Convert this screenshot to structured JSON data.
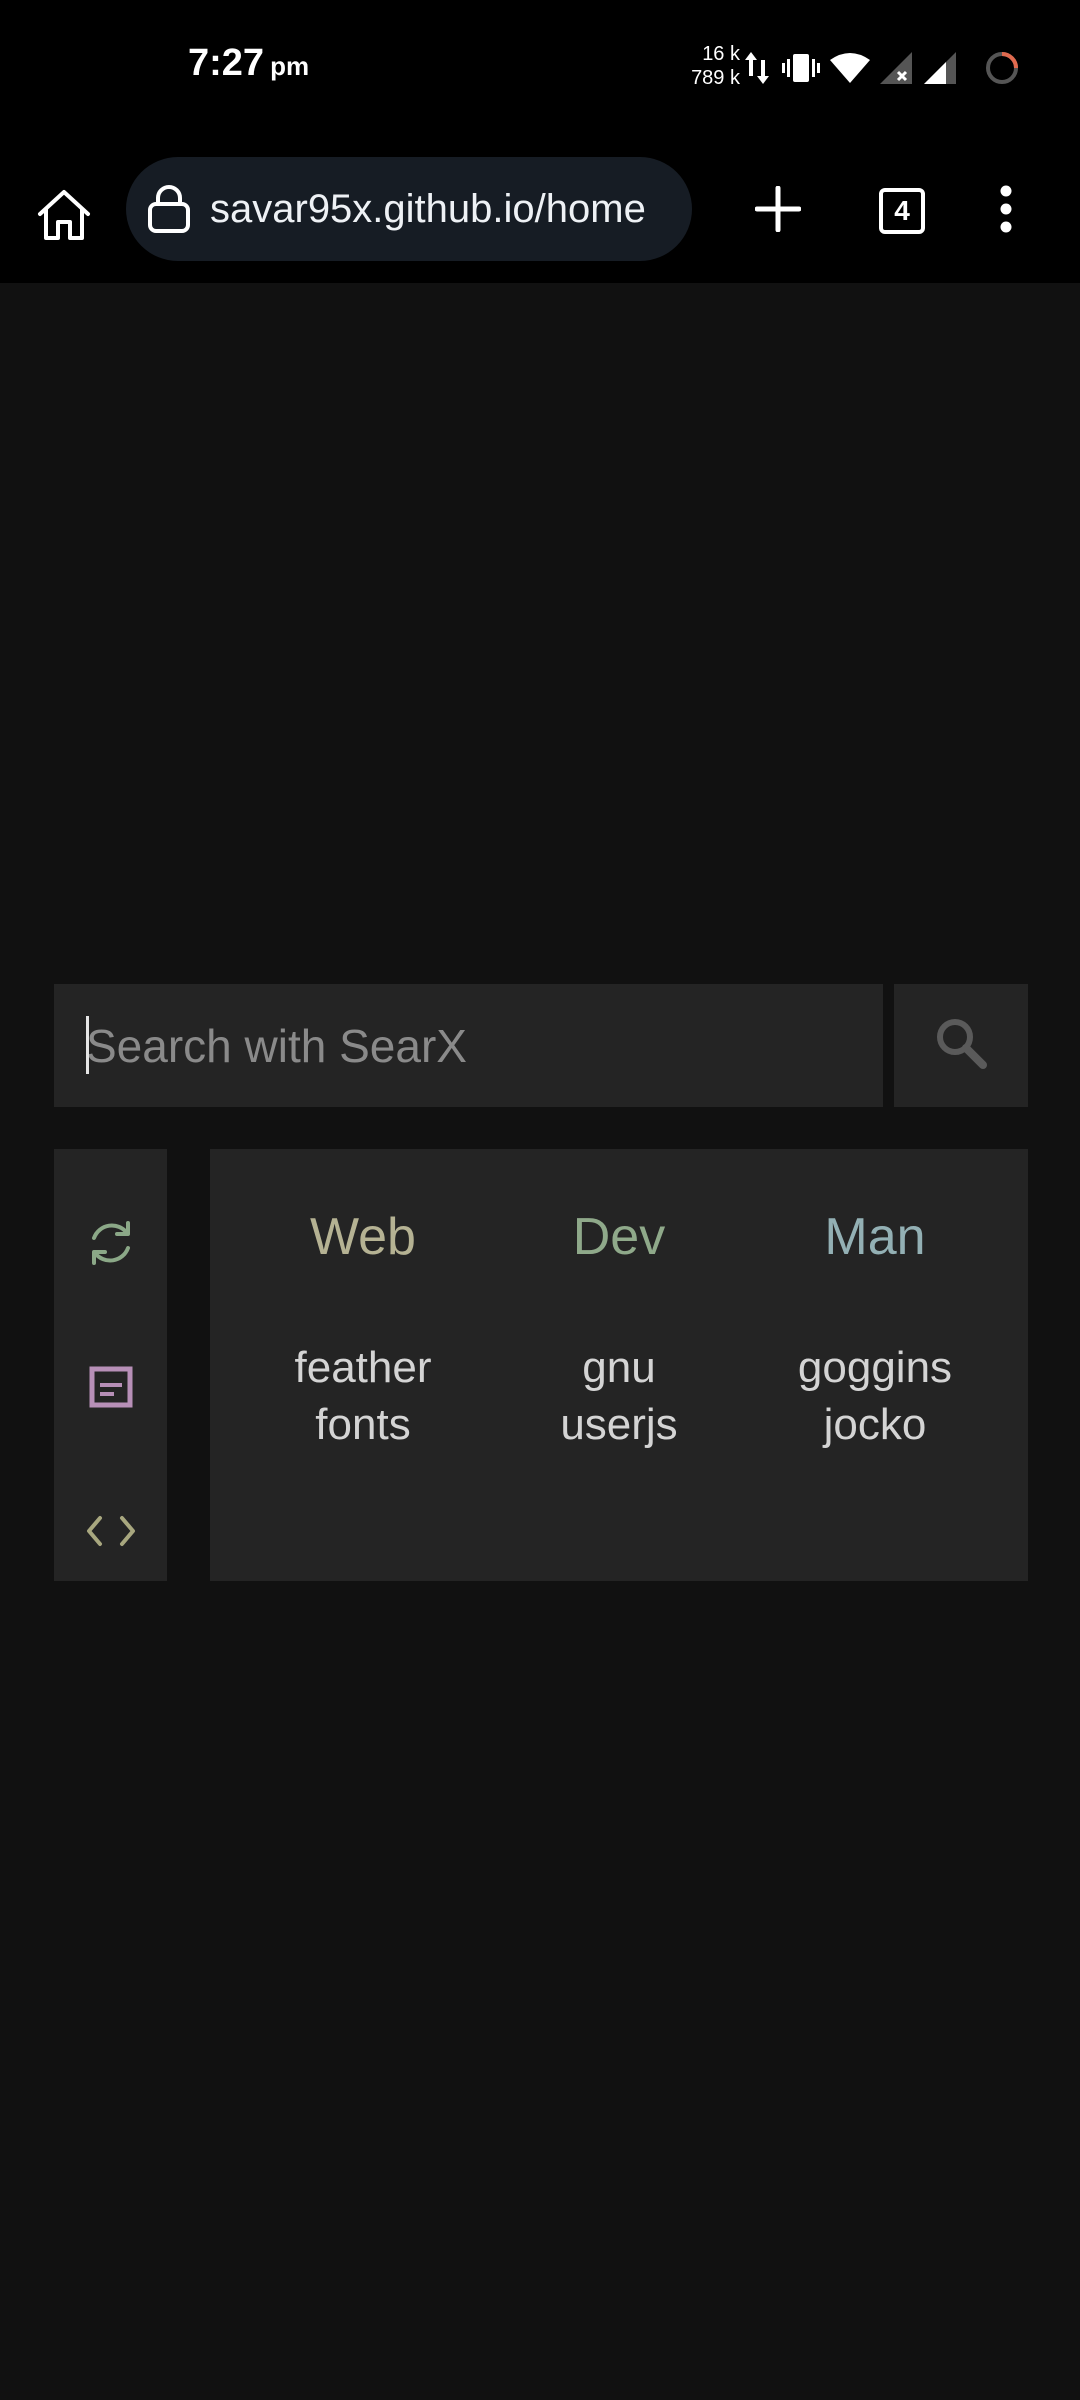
{
  "status_bar": {
    "time": "7:27",
    "ampm": "pm",
    "net_up": "16 k",
    "net_down": "789 k",
    "icons": [
      "data-transfer-icon",
      "vibrate-icon",
      "wifi-icon",
      "signal-no-service-icon",
      "signal-icon",
      "loading-ring-icon"
    ]
  },
  "toolbar": {
    "url": "savar95x.github.io/home",
    "tab_count": "4",
    "icons": [
      "home-icon",
      "lock-icon",
      "plus-icon",
      "tab-switcher-icon",
      "overflow-menu-icon"
    ]
  },
  "search": {
    "placeholder": "Search with SearX",
    "value": ""
  },
  "side_icons": [
    "refresh-icon",
    "notes-icon",
    "code-icon"
  ],
  "bookmarks": {
    "columns": [
      {
        "title": "Web",
        "links": [
          "feather",
          "fonts"
        ]
      },
      {
        "title": "Dev",
        "links": [
          "gnu",
          "userjs"
        ]
      },
      {
        "title": "Man",
        "links": [
          "goggins",
          "jocko"
        ]
      }
    ]
  },
  "colors": {
    "web": "#b5b293",
    "dev": "#8fa98a",
    "man": "#93b0b4",
    "refresh": "#8ba887",
    "notes": "#b78fb7",
    "code": "#a8a77f",
    "panel": "#242424",
    "background": "#111111"
  }
}
